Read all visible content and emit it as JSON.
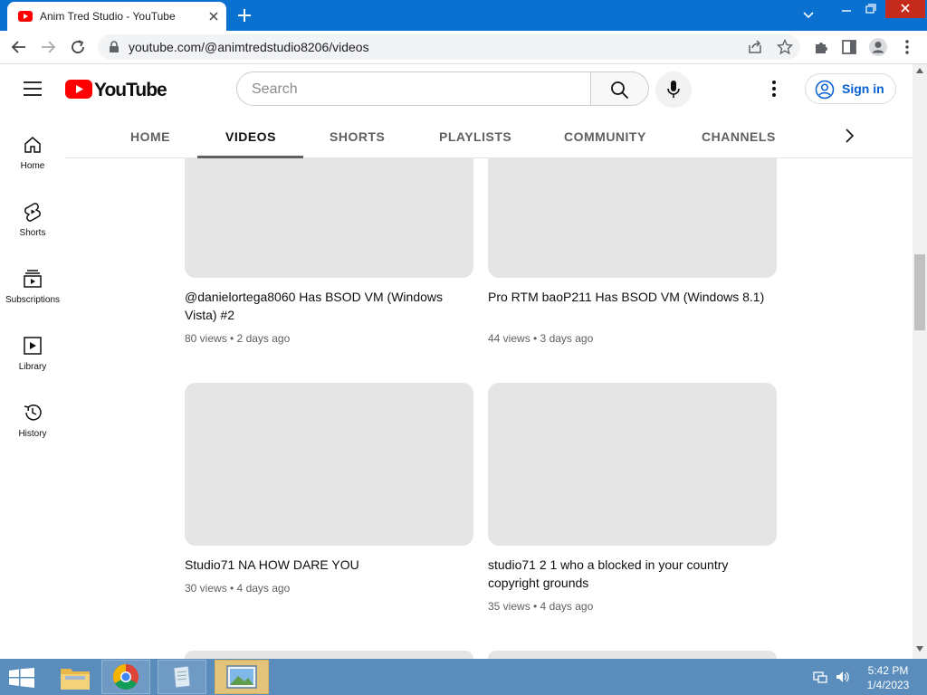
{
  "browser": {
    "tab_title": "Anim Tred Studio - YouTube",
    "url": "youtube.com/@animtredstudio8206/videos"
  },
  "youtube": {
    "logo_text": "YouTube",
    "search_placeholder": "Search",
    "signin_label": "Sign in"
  },
  "channel_tabs": [
    "HOME",
    "VIDEOS",
    "SHORTS",
    "PLAYLISTS",
    "COMMUNITY",
    "CHANNELS"
  ],
  "active_tab": "VIDEOS",
  "guide": [
    {
      "label": "Home",
      "icon": "home-icon"
    },
    {
      "label": "Shorts",
      "icon": "shorts-icon"
    },
    {
      "label": "Subscriptions",
      "icon": "subscriptions-icon"
    },
    {
      "label": "Library",
      "icon": "library-icon"
    },
    {
      "label": "History",
      "icon": "history-icon"
    }
  ],
  "videos": [
    {
      "title": "@danielortega8060 Has BSOD VM (Windows Vista) #2",
      "meta": "80 views • 2 days ago"
    },
    {
      "title": "Pro RTM baoP211 Has BSOD VM (Windows 8.1)",
      "meta": "44 views • 3 days ago"
    },
    {
      "title": "Studio71 NA HOW DARE YOU",
      "meta": "30 views • 4 days ago"
    },
    {
      "title": "studio71 2 1 who a blocked in your country copyright grounds",
      "meta": "35 views • 4 days ago"
    }
  ],
  "taskbar": {
    "time": "5:42 PM",
    "date": "1/4/2023"
  },
  "colors": {
    "tabstrip": "#0a71d0",
    "youtube_red": "#ff0000",
    "signin_blue": "#065fd4",
    "taskbar": "#5a8dbb",
    "thumbnail_placeholder": "#e5e5e5"
  }
}
